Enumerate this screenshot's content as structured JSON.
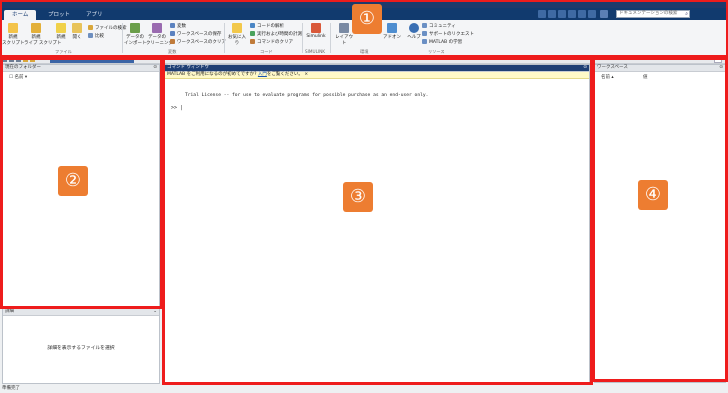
{
  "tabs": [
    {
      "label": "ホーム"
    },
    {
      "label": "プロット"
    },
    {
      "label": "アプリ"
    }
  ],
  "search": {
    "placeholder": "ドキュメンテーションの検索"
  },
  "ribbon": {
    "buttons": [
      {
        "label": "新規\nスクリプト"
      },
      {
        "label": "新規\nライブ スクリプト"
      },
      {
        "label": "新規"
      },
      {
        "label": "開く"
      },
      {
        "label": "データの\nインポート"
      },
      {
        "label": "データの\nクリーニング"
      },
      {
        "label": "お気に入り"
      },
      {
        "label": "Simulink"
      },
      {
        "label": "レイアウト"
      },
      {
        "label": "アドオン"
      },
      {
        "label": "ヘルプ"
      }
    ],
    "file_items": [
      "ファイルの検索",
      "比較"
    ],
    "variable_items": [
      "変数",
      "ワークスペースの保存",
      "ワークスペースのクリア"
    ],
    "code_items": [
      "コードの解析",
      "実行および時間の計測",
      "コマンドのクリア"
    ],
    "resource_items": [
      "コミュニティ",
      "サポートのリクエスト",
      "MATLAB の学習"
    ],
    "groups": [
      "ファイル",
      "変数",
      "コード",
      "SIMULINK",
      "環境",
      "リソース"
    ]
  },
  "file_panel": {
    "title": "現在のフォルダー",
    "column": "名前"
  },
  "details_panel": {
    "title": "詳細",
    "message": "詳細を表示するファイルを選択"
  },
  "command_window": {
    "title": "コマンド ウィンドウ",
    "notice_prefix": "MATLAB をご利用になるのが初めてですか?",
    "notice_link": "入門",
    "notice_suffix": "をご覧ください。",
    "license_text": "Trial License -- for use to evaluate programs for possible purchase as an end-user only.",
    "prompt": ">>"
  },
  "workspace": {
    "title": "ワークスペース",
    "col_name": "名前",
    "col_value": "値"
  },
  "status": {
    "text": "準備完了"
  },
  "callouts": [
    "①",
    "②",
    "③",
    "④"
  ],
  "colors": {
    "accent": "#ed7d31",
    "frame": "#ee1c1c",
    "titlebar": "#113a6e"
  }
}
